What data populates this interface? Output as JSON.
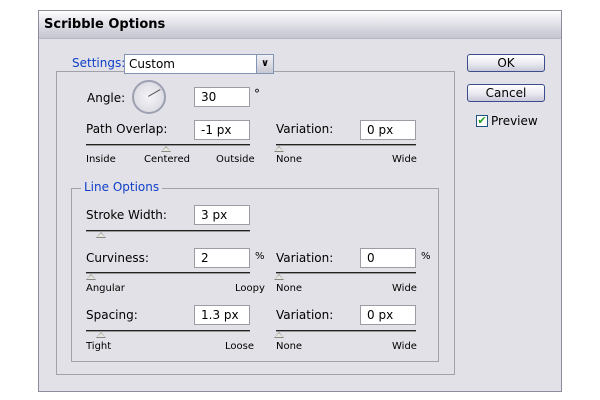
{
  "window": {
    "title": "Scribble Options"
  },
  "settings": {
    "label": "Settings:",
    "value": "Custom"
  },
  "angle": {
    "label": "Angle:",
    "value": "30",
    "unit": "°"
  },
  "path_overlap": {
    "label": "Path Overlap:",
    "value": "-1 px",
    "slider_fraction": 0.48,
    "min_label": "Inside",
    "mid_label": "Centered",
    "max_label": "Outside"
  },
  "path_variation": {
    "label": "Variation:",
    "value": "0 px",
    "slider_fraction": 0.0,
    "min_label": "None",
    "max_label": "Wide"
  },
  "line_options": {
    "label": "Line Options",
    "stroke_width": {
      "label": "Stroke Width:",
      "value": "3 px",
      "slider_fraction": 0.08
    },
    "curviness": {
      "label": "Curviness:",
      "value": "2",
      "unit": "%",
      "slider_fraction": 0.02,
      "min_label": "Angular",
      "max_label": "Loopy"
    },
    "curviness_variation": {
      "label": "Variation:",
      "value": "0",
      "unit": "%",
      "slider_fraction": 0.0,
      "min_label": "None",
      "max_label": "Wide"
    },
    "spacing": {
      "label": "Spacing:",
      "value": "1.3 px",
      "slider_fraction": 0.08,
      "min_label": "Tight",
      "max_label": "Loose"
    },
    "spacing_variation": {
      "label": "Variation:",
      "value": "0 px",
      "slider_fraction": 0.0,
      "min_label": "None",
      "max_label": "Wide"
    }
  },
  "buttons": {
    "ok": "OK",
    "cancel": "Cancel"
  },
  "preview": {
    "label": "Preview",
    "checked": true
  }
}
